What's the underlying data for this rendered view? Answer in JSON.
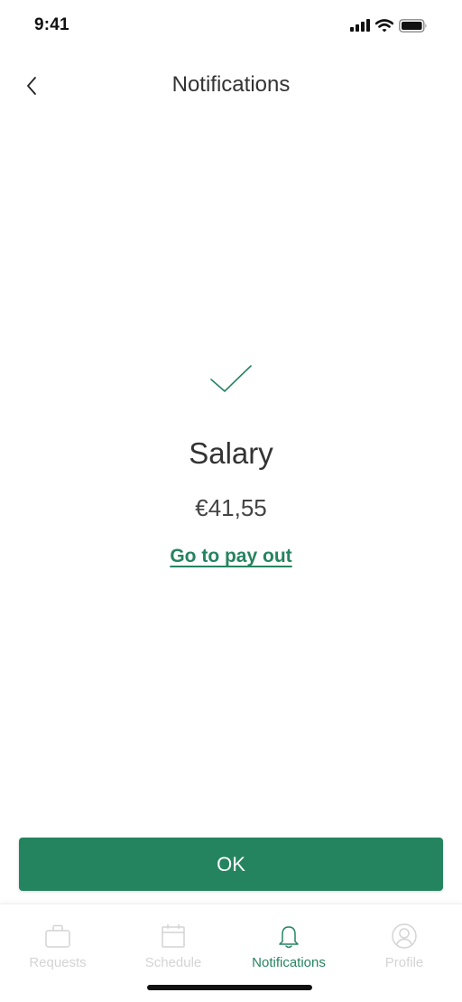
{
  "status_bar": {
    "time": "9:41",
    "icons": [
      "signal-icon",
      "wifi-icon",
      "battery-icon"
    ]
  },
  "header": {
    "title": "Notifications",
    "back_icon": "chevron-left-icon"
  },
  "notification": {
    "icon": "checkmark-icon",
    "title": "Salary",
    "amount": "€41,55",
    "link_label": "Go to pay out"
  },
  "ok_button": {
    "label": "OK"
  },
  "tab_bar": {
    "tabs": [
      {
        "label": "Requests",
        "icon": "briefcase-icon",
        "active": false
      },
      {
        "label": "Schedule",
        "icon": "calendar-icon",
        "active": false
      },
      {
        "label": "Notifications",
        "icon": "bell-icon",
        "active": true
      },
      {
        "label": "Profile",
        "icon": "user-icon",
        "active": false
      }
    ]
  },
  "colors": {
    "accent": "#258460",
    "text": "#333333",
    "inactive_tab": "#d4d4d4"
  }
}
